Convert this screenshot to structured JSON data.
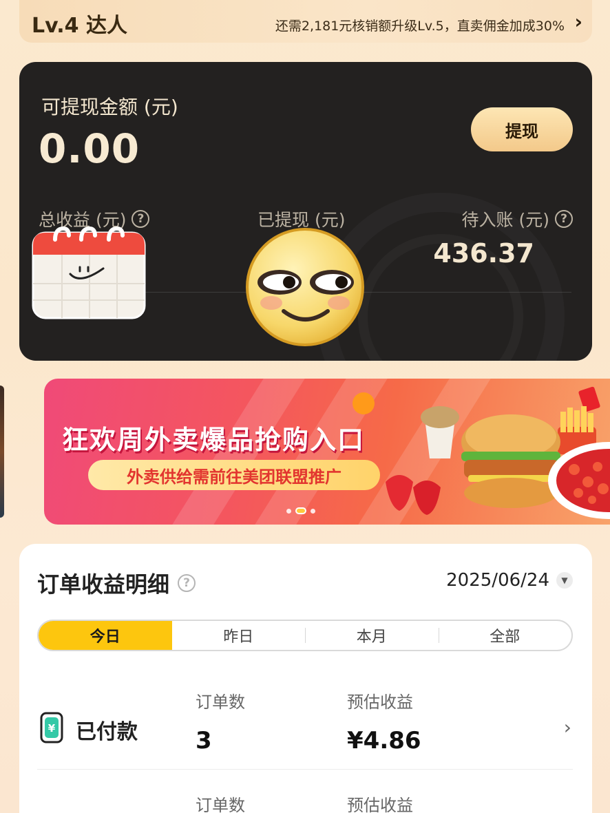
{
  "level": {
    "title": "Lv.4 达人",
    "tip": "还需2,181元核销额升级Lv.5，直卖佣金加成30%",
    "arrow": "›"
  },
  "balance": {
    "withdrawable_label": "可提现金额 (元)",
    "withdrawable_amount": "0.00",
    "withdraw_button": "提现",
    "total_label": "总收益 (元)",
    "withdrawn_label": "已提现 (元)",
    "pending_label": "待入账 (元)",
    "pending_value": "436.37",
    "help_glyph": "?"
  },
  "banner": {
    "title": "狂欢周外卖爆品抢购入口",
    "subtitle": "外卖供给需前往美团联盟推广",
    "slide_count": 3,
    "active_slide": 2
  },
  "orders": {
    "title": "订单收益明细",
    "help_glyph": "?",
    "date": "2025/06/24",
    "tabs": [
      "今日",
      "昨日",
      "本月",
      "全部"
    ],
    "active_tab": 0,
    "rows": [
      {
        "label": "已付款",
        "orders_label": "订单数",
        "orders_value": "3",
        "income_label": "预估收益",
        "income_value": "¥4.86"
      },
      {
        "label": "",
        "orders_label": "订单数",
        "income_label": "预估收益"
      }
    ]
  },
  "colors": {
    "accent_yellow": "#fdc60e",
    "card_dark": "#232120",
    "gold_button": "#f3c98a",
    "banner_pink": "#f04a78"
  }
}
